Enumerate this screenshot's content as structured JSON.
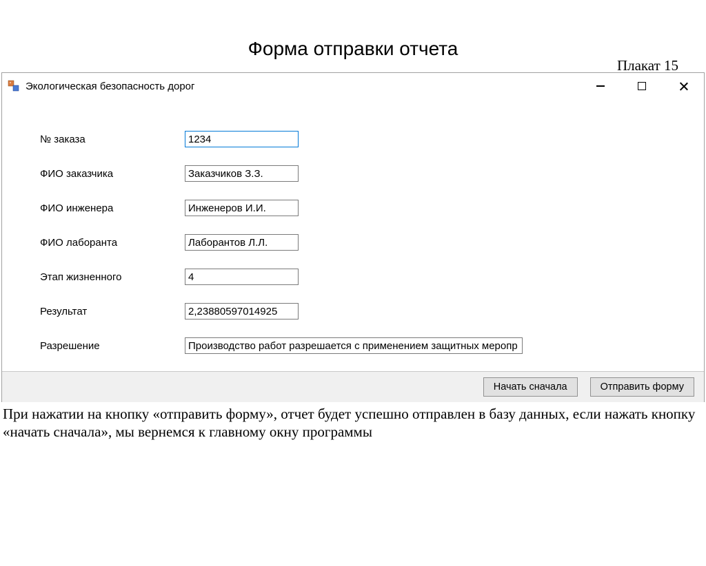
{
  "poster_label": "Плакат 15",
  "page_title": "Форма отправки отчета",
  "window": {
    "title": "Экологическая безопасность дорог"
  },
  "form": {
    "labels": {
      "order_no": "№ заказа",
      "customer_name": "ФИО заказчика",
      "engineer_name": "ФИО инженера",
      "labassistant_name": "ФИО лаборанта",
      "lifecycle_stage": "Этап жизненного",
      "result": "Результат",
      "resolution": "Разрешение"
    },
    "values": {
      "order_no": "1234",
      "customer_name": "Заказчиков З.З.",
      "engineer_name": "Инженеров И.И.",
      "labassistant_name": "Лаборантов Л.Л.",
      "lifecycle_stage": "4",
      "result": "2,23880597014925",
      "resolution": "Производство работ разрешается с применением защитных меропр"
    }
  },
  "buttons": {
    "restart": "Начать сначала",
    "submit": "Отправить форму"
  },
  "description": "При нажатии на кнопку «отправить форму», отчет будет успешно отправлен в базу данных, если нажать кнопку «начать сначала», мы вернемся к главному окну программы"
}
